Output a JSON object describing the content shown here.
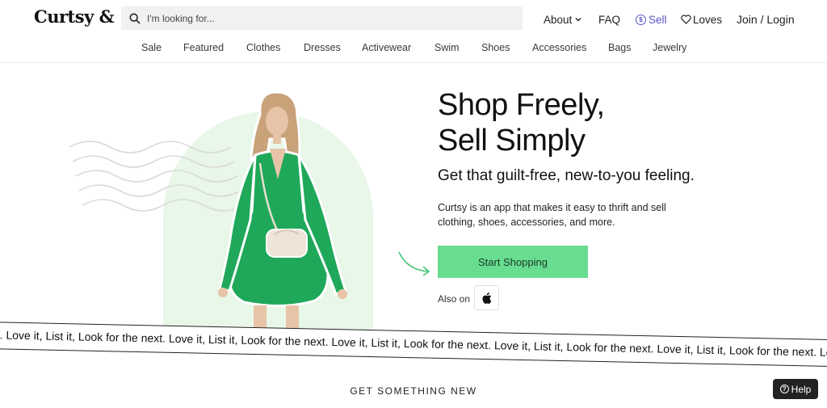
{
  "header": {
    "logo": "Curtsy &",
    "search_placeholder": "I'm looking for...",
    "nav": {
      "about": "About",
      "faq": "FAQ",
      "sell": "Sell",
      "loves": "Loves",
      "join": "Join / Login"
    },
    "categories": [
      "Sale",
      "Featured",
      "Clothes",
      "Dresses",
      "Activewear",
      "Swim",
      "Shoes",
      "Accessories",
      "Bags",
      "Jewelry"
    ]
  },
  "hero": {
    "title_line1": "Shop Freely,",
    "title_line2": "Sell Simply",
    "subtitle": "Get that guilt-free, new-to-you feeling.",
    "description": "Curtsy is an app that makes it easy to thrift and sell clothing, shoes, accessories, and more.",
    "cta": "Start Shopping",
    "also_on": "Also on"
  },
  "ticker": {
    "text": ". Love it, List it, Look for the next. Love it, List it, Look for the next. Love it, List it, Look for the next. Love it, List it, Look for the next. Love it, List it, Look for the next. Love"
  },
  "section": {
    "title": "GET SOMETHING NEW"
  },
  "help": {
    "label": "Help"
  },
  "colors": {
    "accent_green": "#68dd90",
    "sell_purple": "#5b57c7",
    "arch_green": "#e8f7e8"
  },
  "icons": [
    "search-icon",
    "chevron-down-icon",
    "sell-coin-icon",
    "heart-icon",
    "apple-icon",
    "arrow-icon",
    "help-icon"
  ]
}
